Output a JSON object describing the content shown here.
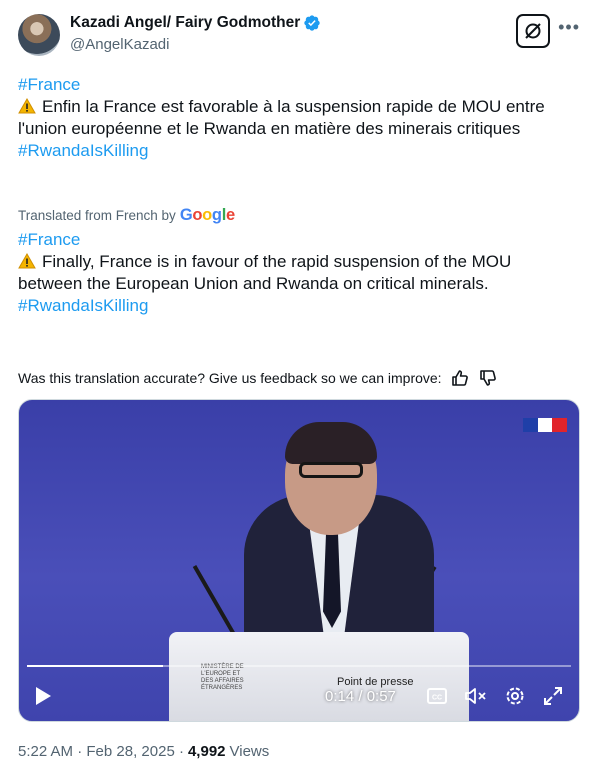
{
  "author": {
    "display_name": "Kazadi Angel/ Fairy Godmother",
    "handle": "@AngelKazadi"
  },
  "tweet": {
    "hashtag_top": "#France",
    "text": "Enfin la France est favorable à la suspension rapide de MOU entre l'union européenne et le Rwanda  en matière des minerais critiques",
    "hashtag_bottom": "#RwandaIsKilling"
  },
  "translation": {
    "label": "Translated from French by",
    "provider": "Google",
    "hashtag_top": "#France",
    "text": "Finally, France is in favour of the rapid suspension of the MOU between the European Union and Rwanda on critical minerals.",
    "hashtag_bottom": "#RwandaIsKilling",
    "feedback_prompt": "Was this translation accurate? Give us feedback so we can improve:"
  },
  "video": {
    "current_time": "0:14",
    "duration": "0:57",
    "time_display": "0:14 / 0:57",
    "progress": 0.25,
    "podium_text": "Point de presse",
    "podium_logo_text": "MINISTÈRE DE L'EUROPE ET DES AFFAIRES ÉTRANGÈRES",
    "cc_label": "CC"
  },
  "meta": {
    "time": "5:22 AM",
    "date": "Feb 28, 2025",
    "views_count": "4,992",
    "views_label": "Views"
  },
  "colors": {
    "link": "#1d9bf0",
    "verified": "#1d9bf0",
    "secondary_text": "#536471"
  },
  "icons": [
    "verified-badge-icon",
    "grok-icon",
    "more-icon",
    "warning-icon",
    "thumbs-up-icon",
    "thumbs-down-icon",
    "play-icon",
    "captions-icon",
    "mute-icon",
    "settings-icon",
    "fullscreen-icon"
  ]
}
